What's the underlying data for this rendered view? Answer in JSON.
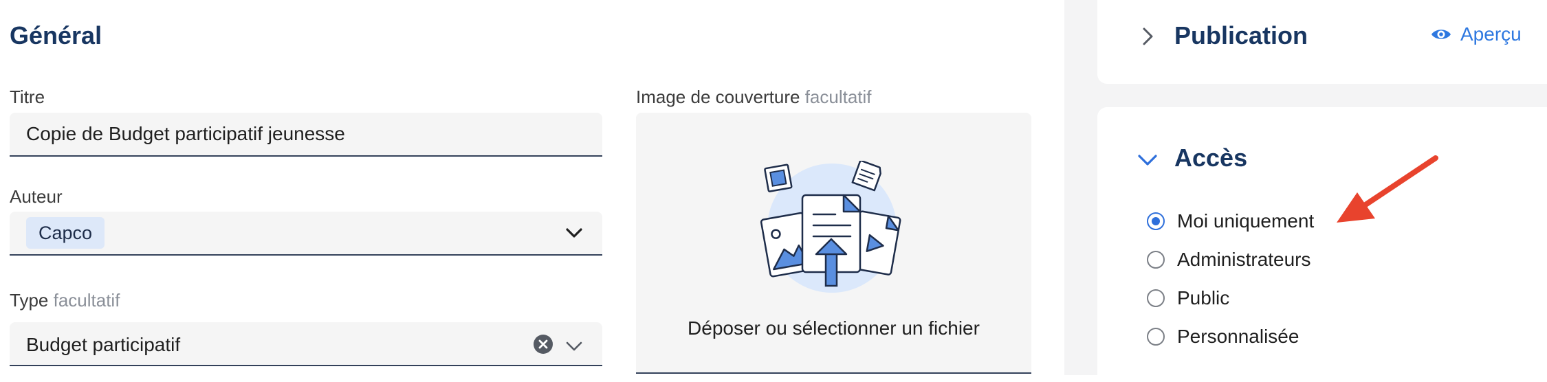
{
  "general": {
    "title": "Général",
    "title_field": {
      "label": "Titre",
      "value": "Copie de Budget participatif jeunesse"
    },
    "author_field": {
      "label": "Auteur",
      "tag": "Capco"
    },
    "type_field": {
      "label": "Type",
      "optional": "facultatif",
      "value": "Budget participatif"
    },
    "cover_field": {
      "label": "Image de couverture",
      "optional": "facultatif",
      "drop_text": "Déposer ou sélectionner un fichier"
    }
  },
  "publication": {
    "title": "Publication",
    "preview_label": "Aperçu"
  },
  "access": {
    "title": "Accès",
    "options": [
      {
        "label": "Moi uniquement",
        "checked": true
      },
      {
        "label": "Administrateurs",
        "checked": false
      },
      {
        "label": "Public",
        "checked": false
      },
      {
        "label": "Personnalisée",
        "checked": false
      }
    ]
  },
  "colors": {
    "accent": "#2e6fdb",
    "heading": "#183661",
    "annotation_arrow": "#e8432d"
  }
}
